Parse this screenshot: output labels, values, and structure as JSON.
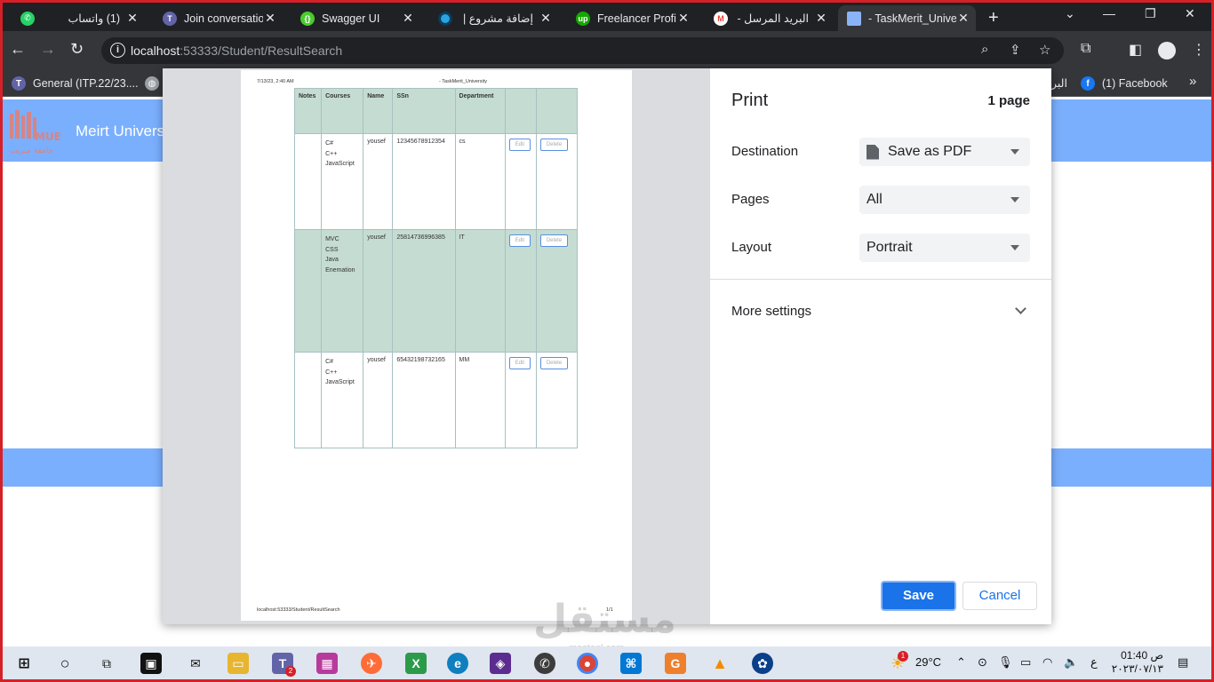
{
  "browser": {
    "tabs": [
      {
        "title": "(1) واتساب",
        "icon": "whatsapp-icon",
        "color": "#25d366"
      },
      {
        "title": "Join conversation",
        "icon": "teams-icon",
        "color": "#6264a7"
      },
      {
        "title": "Swagger UI",
        "icon": "swagger-icon",
        "color": "#49cc2d"
      },
      {
        "title": "إضافة مشروع | م",
        "icon": "mostaql-icon",
        "color": "#2aa3e0"
      },
      {
        "title": "Freelancer Profile",
        "icon": "upwork-icon",
        "color": "#14a800"
      },
      {
        "title": "البريد المرسل - l",
        "icon": "gmail-icon",
        "color": "#ea4335"
      },
      {
        "title": "- TaskMerit_University",
        "icon": "page-icon",
        "color": "#8ab4f8"
      }
    ],
    "address": {
      "host": "localhost",
      "path": ":53333/Student/ResultSearch"
    },
    "bookmarks": [
      {
        "label": "General (ITP.22/23....",
        "icon": "teams-icon"
      },
      {
        "label": "البر",
        "icon": "globe-icon"
      },
      {
        "label": "(1) Facebook",
        "icon": "facebook-icon"
      }
    ]
  },
  "site": {
    "logo_text": "MUE",
    "logo_sub": "جامعة ميريت",
    "brand": "Meirt Universt"
  },
  "print": {
    "title": "Print",
    "page_count": "1 page",
    "destination_label": "Destination",
    "destination_value": "Save as PDF",
    "pages_label": "Pages",
    "pages_value": "All",
    "layout_label": "Layout",
    "layout_value": "Portrait",
    "more_settings": "More settings",
    "save": "Save",
    "cancel": "Cancel"
  },
  "sheet": {
    "header_date": "7/13/23, 2:40 AM",
    "header_title": "- TaskMerit_University",
    "footer_url": "localhost:53333/Student/ResultSearch",
    "footer_page": "1/1",
    "columns": [
      "Notes",
      "Courses",
      "Name",
      "SSn",
      "Department",
      "",
      ""
    ],
    "rows": [
      {
        "notes": "",
        "courses": [
          "C#",
          "C++",
          "JavaScript"
        ],
        "name": "yousef",
        "ssn": "12345678912354",
        "department": "cs",
        "edit": "Edit",
        "delete": "Delete"
      },
      {
        "notes": "",
        "courses": [
          "MVC",
          "CSS",
          "Java",
          "Enemation"
        ],
        "name": "yousef",
        "ssn": "25814736996385",
        "department": "IT",
        "edit": "Edit",
        "delete": "Delete"
      },
      {
        "notes": "",
        "courses": [
          "C#",
          "C++",
          "JavaScript"
        ],
        "name": "yousef",
        "ssn": "65432198732165",
        "department": "MM",
        "edit": "Edit",
        "delete": "Delete"
      }
    ]
  },
  "watermark": {
    "text": "مستقل",
    "sub": "mostaql.com"
  },
  "taskbar": {
    "temperature": "29°C",
    "lang": "ع",
    "time": "01:40 ص",
    "date": "٢٠٢٣/٠٧/١٣",
    "weather_badge": "1",
    "teams_badge": "2"
  }
}
